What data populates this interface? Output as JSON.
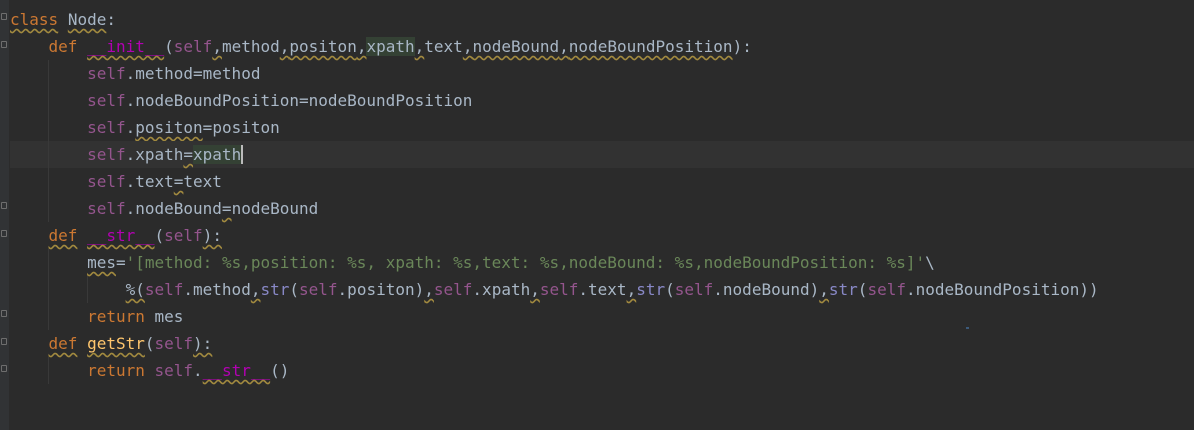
{
  "editor": {
    "lines": [
      {
        "segments": [
          {
            "t": "class",
            "c": "kw warn"
          },
          {
            "t": " "
          },
          {
            "t": "Node",
            "c": "warn"
          },
          {
            "t": ":"
          }
        ]
      },
      {
        "segments": [
          {
            "t": "    "
          },
          {
            "t": "def",
            "c": "kw"
          },
          {
            "t": " "
          },
          {
            "t": "__init__",
            "c": "magic warn"
          },
          {
            "t": "("
          },
          {
            "t": "self",
            "c": "self"
          },
          {
            "t": ",",
            "c": "warn"
          },
          {
            "t": "method"
          },
          {
            "t": ",",
            "c": "warn"
          },
          {
            "t": "positon",
            "c": "warn"
          },
          {
            "t": ",",
            "c": "warn"
          },
          {
            "t": "xpath",
            "c": "hl"
          },
          {
            "t": ",",
            "c": "warn"
          },
          {
            "t": "text"
          },
          {
            "t": ",",
            "c": "warn"
          },
          {
            "t": "nodeBound",
            "c": "warn"
          },
          {
            "t": ",",
            "c": "warn"
          },
          {
            "t": "nodeBoundPosition",
            "c": "warn"
          },
          {
            "t": "):"
          }
        ]
      },
      {
        "segments": [
          {
            "t": "        "
          },
          {
            "t": "self",
            "c": "self"
          },
          {
            "t": ".method=method"
          }
        ]
      },
      {
        "segments": [
          {
            "t": "        "
          },
          {
            "t": "self",
            "c": "self"
          },
          {
            "t": ".nodeBoundPosition=nodeBoundPosition"
          }
        ]
      },
      {
        "segments": [
          {
            "t": "        "
          },
          {
            "t": "self",
            "c": "self"
          },
          {
            "t": "."
          },
          {
            "t": "positon",
            "c": "warn"
          },
          {
            "t": "="
          },
          {
            "t": "positon"
          }
        ]
      },
      {
        "current": true,
        "caret_after": true,
        "segments": [
          {
            "t": "        "
          },
          {
            "t": "self",
            "c": "self"
          },
          {
            "t": ".xpath"
          },
          {
            "t": "=",
            "c": "warn"
          },
          {
            "t": "xpath",
            "c": "hl"
          }
        ]
      },
      {
        "segments": [
          {
            "t": "        "
          },
          {
            "t": "self",
            "c": "self"
          },
          {
            "t": ".text"
          },
          {
            "t": "=",
            "c": "warn"
          },
          {
            "t": "text"
          }
        ]
      },
      {
        "segments": [
          {
            "t": "        "
          },
          {
            "t": "self",
            "c": "self"
          },
          {
            "t": ".nodeBound"
          },
          {
            "t": "=",
            "c": "warn"
          },
          {
            "t": "nodeBound"
          }
        ]
      },
      {
        "segments": [
          {
            "t": "    "
          },
          {
            "t": "def",
            "c": "kw warn"
          },
          {
            "t": " "
          },
          {
            "t": "__str__",
            "c": "magic warn"
          },
          {
            "t": "("
          },
          {
            "t": "self",
            "c": "self"
          },
          {
            "t": "):",
            "c": "warn"
          }
        ]
      },
      {
        "segments": [
          {
            "t": "        "
          },
          {
            "t": "mes",
            "c": "warn"
          },
          {
            "t": "="
          },
          {
            "t": "'[method: %s,position: %s, xpath: %s,text: %s,nodeBound: %s,nodeBoundPosition: %s]'",
            "c": "str"
          },
          {
            "t": "\\"
          }
        ]
      },
      {
        "segments": [
          {
            "t": "            "
          },
          {
            "t": "%(",
            "c": "warn"
          },
          {
            "t": "self",
            "c": "self"
          },
          {
            "t": ".method"
          },
          {
            "t": ",",
            "c": "warn"
          },
          {
            "t": "str",
            "c": "builtin"
          },
          {
            "t": "("
          },
          {
            "t": "self",
            "c": "self"
          },
          {
            "t": ".positon)"
          },
          {
            "t": ",",
            "c": "warn"
          },
          {
            "t": "self",
            "c": "self"
          },
          {
            "t": ".xpath"
          },
          {
            "t": ",",
            "c": "warn"
          },
          {
            "t": "self",
            "c": "self"
          },
          {
            "t": ".text"
          },
          {
            "t": ",",
            "c": "warn"
          },
          {
            "t": "str",
            "c": "builtin"
          },
          {
            "t": "("
          },
          {
            "t": "self",
            "c": "self"
          },
          {
            "t": ".nodeBound)"
          },
          {
            "t": ",",
            "c": "warn"
          },
          {
            "t": "str",
            "c": "builtin"
          },
          {
            "t": "("
          },
          {
            "t": "self",
            "c": "self"
          },
          {
            "t": ".nodeBoundPosition))"
          }
        ]
      },
      {
        "segments": [
          {
            "t": "        "
          },
          {
            "t": "return",
            "c": "kw"
          },
          {
            "t": " mes"
          }
        ]
      },
      {
        "segments": [
          {
            "t": "    "
          },
          {
            "t": "def",
            "c": "kw warn"
          },
          {
            "t": " "
          },
          {
            "t": "getStr",
            "c": "fn warn"
          },
          {
            "t": "("
          },
          {
            "t": "self",
            "c": "self"
          },
          {
            "t": "):",
            "c": "warn"
          }
        ]
      },
      {
        "segments": [
          {
            "t": "        "
          },
          {
            "t": "return",
            "c": "kw"
          },
          {
            "t": " "
          },
          {
            "t": "self",
            "c": "self"
          },
          {
            "t": "."
          },
          {
            "t": "__str__",
            "c": "magic warn"
          },
          {
            "t": "()"
          }
        ]
      }
    ]
  }
}
